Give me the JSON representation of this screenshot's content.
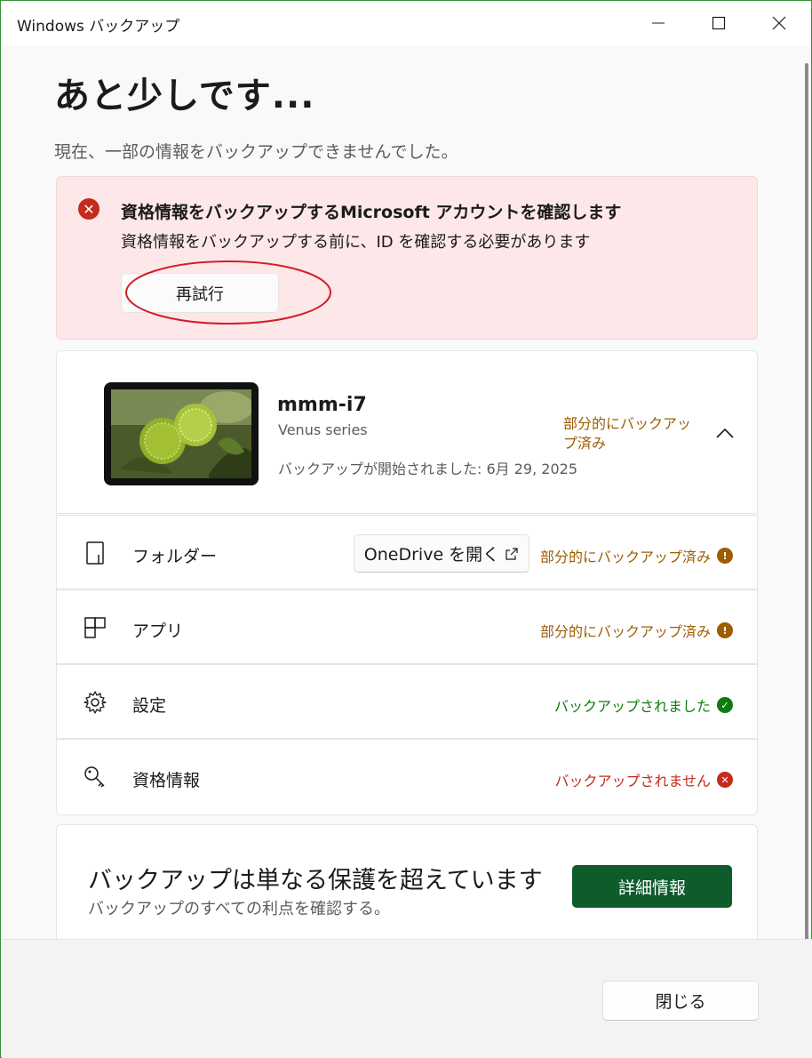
{
  "window": {
    "title": "Windows バックアップ"
  },
  "page": {
    "heading": "あと少しです...",
    "subtitle": "現在、一部の情報をバックアップできませんでした。"
  },
  "alert": {
    "title": "資格情報をバックアップするMicrosoft アカウントを確認します",
    "description": "資格情報をバックアップする前に、ID を確認する必要があります",
    "retry_label": "再試行",
    "icon": "error-circle-icon"
  },
  "device": {
    "name": "mmm-i7",
    "model": "Venus series",
    "backup_started": "バックアップが開始されました: 6月 29, 2025",
    "status": "部分的にバックアップ済み"
  },
  "items": [
    {
      "label": "フォルダー",
      "status": "部分的にバックアップ済み",
      "state": "warning",
      "icon": "folder-icon",
      "action_label": "OneDrive を開く"
    },
    {
      "label": "アプリ",
      "status": "部分的にバックアップ済み",
      "state": "warning",
      "icon": "apps-icon"
    },
    {
      "label": "設定",
      "status": "バックアップされました",
      "state": "success",
      "icon": "gear-icon"
    },
    {
      "label": "資格情報",
      "status": "バックアップされません",
      "state": "error",
      "icon": "key-icon"
    }
  ],
  "promo": {
    "title": "バックアップは単なる保護を超えています",
    "description": "バックアップのすべての利点を確認する。",
    "button_label": "詳細情報"
  },
  "footer": {
    "close_label": "閉じる"
  },
  "colors": {
    "accent_green": "#0e5b2c",
    "warning": "#9d5d00",
    "success": "#0f7b0f",
    "error": "#c42b1c",
    "alert_bg": "#fde7e9"
  }
}
